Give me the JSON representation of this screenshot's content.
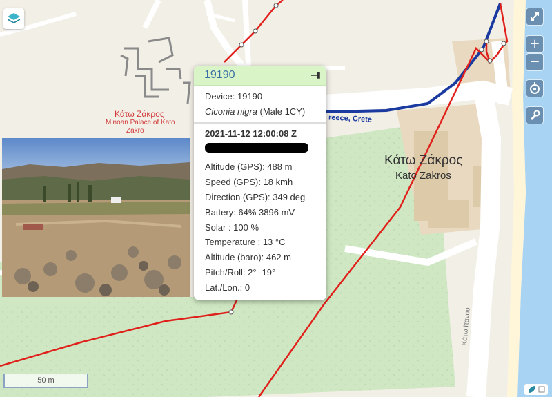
{
  "map_labels": {
    "site_greek": "Κάτω Ζάκρος",
    "site_english": "Minoan Palace of Kato",
    "site_english2": "Zakro",
    "town_greek": "Κάτω Ζάκρος",
    "town_english": "Kato Zakros",
    "road_label": "reece, Crete",
    "road_label_bottom": "Kάτω Ιτανου"
  },
  "popup": {
    "title": "19190",
    "device": "Device: 19190",
    "species": "Ciconia nigra",
    "species_note": " (Male 1CY)",
    "datetime": "2021-11-12 12:00:08 Z",
    "fields": [
      "Altitude  (GPS): 488 m",
      "Speed  (GPS): 18 kmh",
      "Direction  (GPS): 349 deg",
      "Battery: 64% 3896 mV",
      "Solar : 100 %",
      "Temperature : 13 °C",
      "Altitude  (baro): 462 m",
      "Pitch/Roll: 2° -19°",
      "Lat./Lon.: 0"
    ]
  },
  "scale_label": "50 m",
  "controls": {
    "zoom_in": "+",
    "zoom_out": "−",
    "fullscreen_icon": "expand-icon",
    "locate_icon": "locate-icon",
    "settings_icon": "wrench-icon"
  },
  "colors": {
    "track": "#e0201b",
    "road_major": "#1a3aa0",
    "popup_header": "#d9f5c8",
    "title": "#3a6ea5",
    "water": "#a9d3f2",
    "control": "#6b8fb0"
  }
}
